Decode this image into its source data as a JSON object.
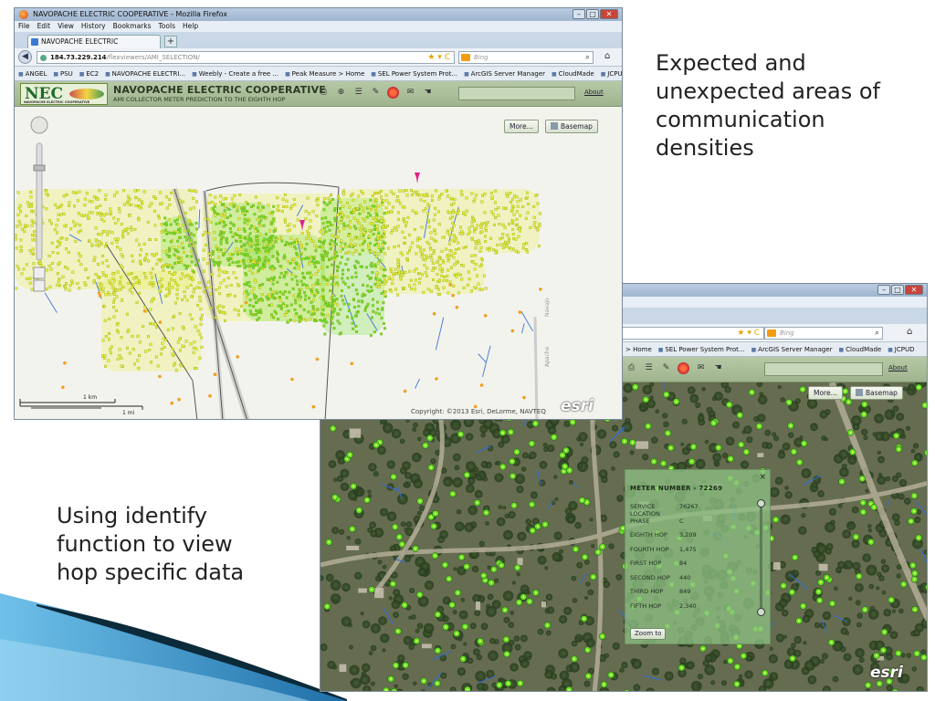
{
  "captions": {
    "top_right": "Expected and\nunexpected areas of\ncommunication\ndensities",
    "bottom_left": "Using identify\nfunction to view\nhop specific data"
  },
  "window1": {
    "title": "NAVOPACHE ELECTRIC COOPERATIVE - Mozilla Firefox",
    "menu": [
      "File",
      "Edit",
      "View",
      "History",
      "Bookmarks",
      "Tools",
      "Help"
    ],
    "tab_label": "NAVOPACHE ELECTRIC COOPERATIVE",
    "tab_add": "+",
    "url_host": "184.73.229.214",
    "url_path": "/flexviewers/AMI_SELECTION/",
    "search_placeholder": "Bing",
    "bookmarks": [
      "ANGEL",
      "PSU",
      "EC2",
      "NAVOPACHE ELECTRI...",
      "Weebly - Create a free ...",
      "Peak Measure > Home",
      "SEL Power System Prot...",
      "ArcGIS Server Manager",
      "CloudMade",
      "JCPUD"
    ],
    "app": {
      "logo_text": "NEC",
      "logo_tag": "NAVOPACHE ELECTRIC COOPERATIVE",
      "title": "NAVOPACHE ELECTRIC COOPERATIVE",
      "subtitle": "AMI COLLECTOR METER PREDICTION TO THE EIGHTH HOP",
      "about": "About"
    },
    "map": {
      "more_label": "More...",
      "basemap_label": "Basemap",
      "scale_km": "1 km",
      "scale_mi": "1 mi",
      "copyright": "Copyright: ©2013 Esri, DeLorme, NAVTEQ",
      "esri": "esri",
      "road_label_1": "Navajo",
      "road_label_2": "Apache"
    }
  },
  "window2": {
    "search_placeholder": "Bing",
    "bookmarks": [
      "> Home",
      "SEL Power System Prot...",
      "ArcGIS Server Manager",
      "CloudMade",
      "JCPUD"
    ],
    "about": "About",
    "more_label": "More...",
    "basemap_label": "Basemap",
    "esri": "esri",
    "popup": {
      "title": "METER NUMBER - 72269",
      "close": "×",
      "rows": [
        {
          "label": "SERVICE LOCATION",
          "value": "76267"
        },
        {
          "label": "PHASE",
          "value": "C"
        },
        {
          "label": "EIGHTH HOP",
          "value": "3,209"
        },
        {
          "label": "FOURTH HOP",
          "value": "1,475"
        },
        {
          "label": "FIRST HOP",
          "value": "84"
        },
        {
          "label": "SECOND HOP",
          "value": "440"
        },
        {
          "label": "THIRD HOP",
          "value": "849"
        },
        {
          "label": "FIFTH HOP",
          "value": "2,340"
        }
      ],
      "zoom_label": "Zoom to"
    }
  },
  "colors": {
    "swoosh_dark": "#0b2a3a",
    "swoosh_blue": "#2d8fd0",
    "meter_yellow": "#e6f03a",
    "meter_green": "#6ae12a",
    "marker_pink": "#e0208c"
  }
}
